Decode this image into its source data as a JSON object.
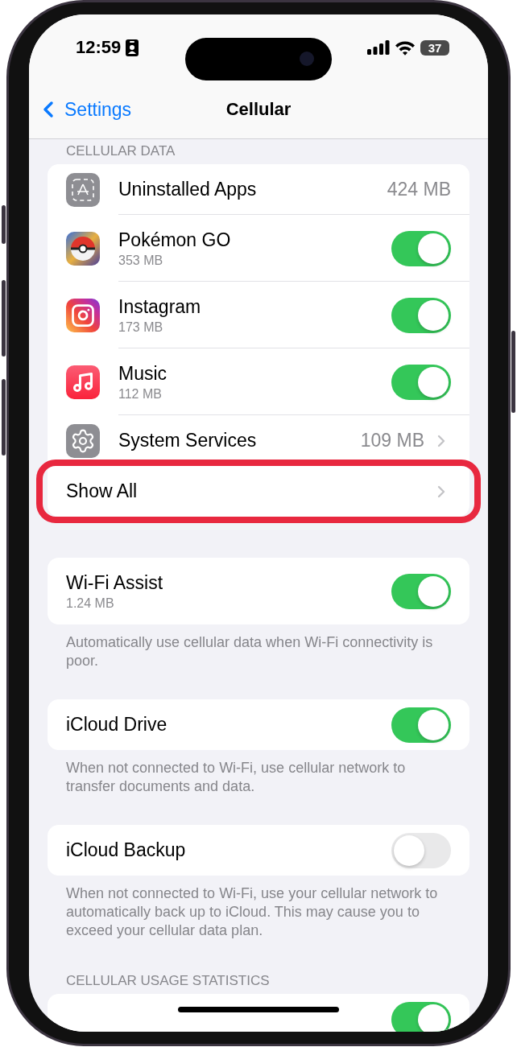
{
  "status_bar": {
    "time": "12:59",
    "battery": "37"
  },
  "nav": {
    "back": "Settings",
    "title": "Cellular"
  },
  "sections": [
    {
      "header": "CELLULAR DATA",
      "rows": [
        {
          "kind": "value",
          "label": "Uninstalled Apps",
          "value": "424 MB"
        },
        {
          "kind": "toggle",
          "label": "Pokémon GO",
          "sub": "353 MB",
          "on": true
        },
        {
          "kind": "toggle",
          "label": "Instagram",
          "sub": "173 MB",
          "on": true
        },
        {
          "kind": "toggle",
          "label": "Music",
          "sub": "112 MB",
          "on": true
        },
        {
          "kind": "link",
          "label": "System Services",
          "value": "109 MB"
        },
        {
          "kind": "link",
          "label": "Show All",
          "highlighted": true
        }
      ]
    },
    {
      "rows": [
        {
          "kind": "toggle",
          "label": "Wi-Fi Assist",
          "sub": "1.24 MB",
          "on": true
        }
      ],
      "footer": "Automatically use cellular data when Wi-Fi connectivity is poor."
    },
    {
      "rows": [
        {
          "kind": "toggle",
          "label": "iCloud Drive",
          "on": true
        }
      ],
      "footer": "When not connected to Wi-Fi, use cellular network to transfer documents and data."
    },
    {
      "rows": [
        {
          "kind": "toggle",
          "label": "iCloud Backup",
          "on": false
        }
      ],
      "footer": "When not connected to Wi-Fi, use your cellular network to automatically back up to iCloud. This may cause you to exceed your cellular data plan."
    },
    {
      "header": "CELLULAR USAGE STATISTICS",
      "rows": [
        {
          "kind": "toggle",
          "on": true
        }
      ]
    }
  ]
}
